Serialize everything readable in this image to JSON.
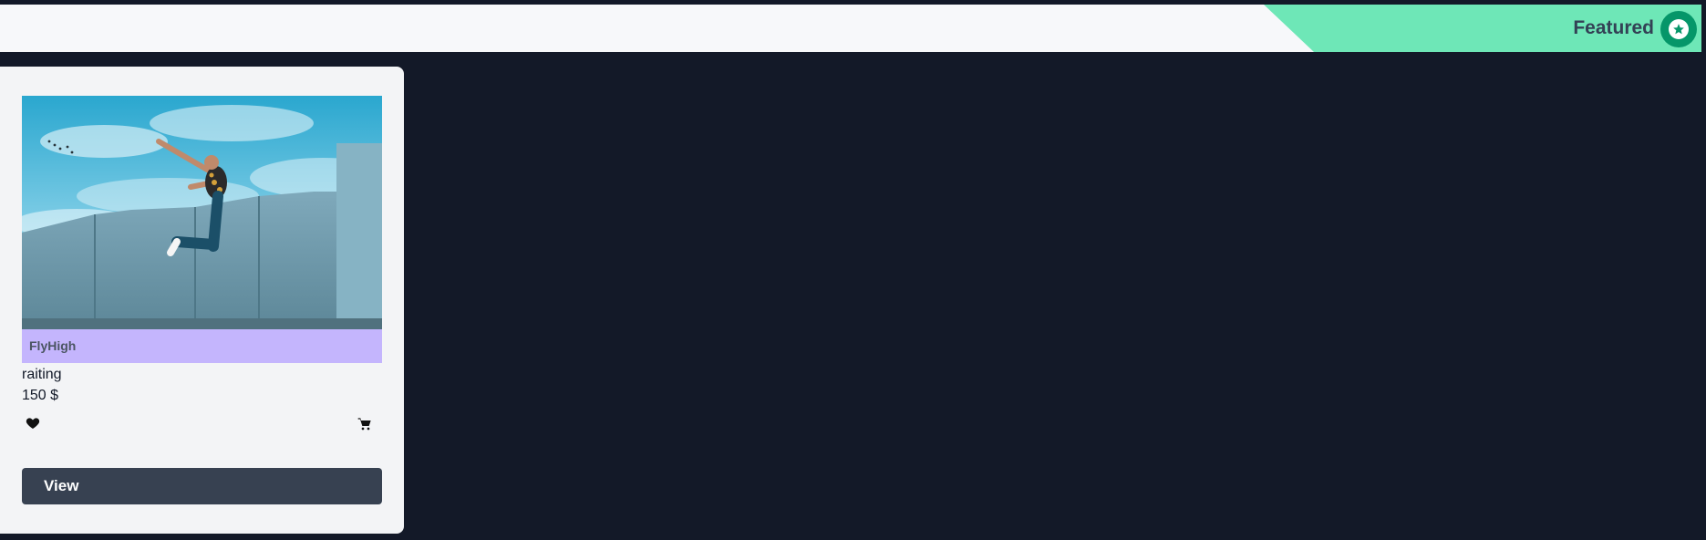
{
  "header": {
    "featured_label": "Featured",
    "badge_icon": "star-icon",
    "ribbon_color": "#6ee7b7",
    "badge_color": "#059669"
  },
  "product": {
    "image_icon": "product-photo-jumping-man",
    "tag": "FlyHigh",
    "rating_label": "raiting",
    "price": "150 $",
    "favorite_icon": "heart-icon",
    "cart_icon": "shopping-cart-icon",
    "view_label": "View",
    "tag_color": "#c4b5fd",
    "button_color": "#374151"
  }
}
